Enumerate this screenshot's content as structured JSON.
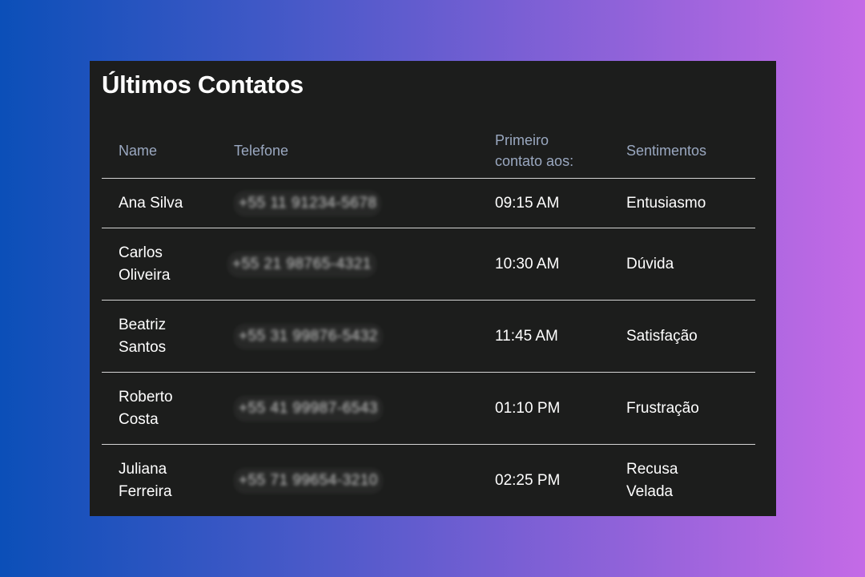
{
  "page": {
    "title": "Últimos Contatos"
  },
  "table": {
    "headers": {
      "name": "Name",
      "phone": "Telefone",
      "first_contact": "Primeiro contato aos:",
      "sentiment": "Sentimentos"
    },
    "rows": [
      {
        "name": "Ana Silva",
        "phone": "+55 11 91234-5678",
        "time": "09:15 AM",
        "sentiment": "Entusiasmo"
      },
      {
        "name": "Carlos Oliveira",
        "phone": "+55 21 98765-4321",
        "time": "10:30 AM",
        "sentiment": "Dúvida"
      },
      {
        "name": "Beatriz Santos",
        "phone": "+55 31 99876-5432",
        "time": "11:45 AM",
        "sentiment": "Satisfação"
      },
      {
        "name": "Roberto Costa",
        "phone": "+55 41 99987-6543",
        "time": "01:10 PM",
        "sentiment": "Frustração"
      },
      {
        "name": "Juliana Ferreira",
        "phone": "+55 71 99654-3210",
        "time": "02:25 PM",
        "sentiment": "Recusa Velada"
      }
    ]
  },
  "colors": {
    "panel_background": "#1c1d1c",
    "header_text": "#9aa8c0",
    "row_divider": "#d4d4d4",
    "gradient_start": "#0b4fb8",
    "gradient_end": "#c46ae6"
  }
}
